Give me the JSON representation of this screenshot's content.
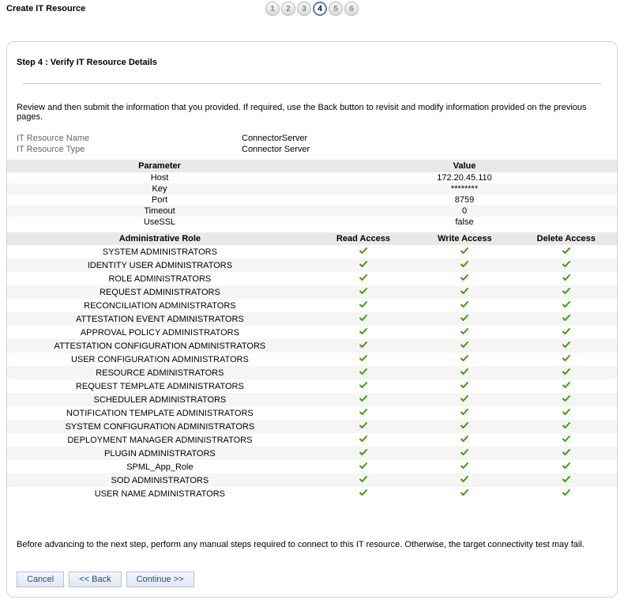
{
  "header": {
    "title": "Create IT Resource",
    "steps": [
      "1",
      "2",
      "3",
      "4",
      "5",
      "6"
    ],
    "active_step_index": 3
  },
  "panel": {
    "step_heading": "Step 4 : Verify IT Resource Details",
    "instruction": "Review and then submit the information that you provided. If required, use the Back button to revisit and modify information provided on the previous pages.",
    "meta": {
      "name_label": "IT Resource Name",
      "name_value": "ConnectorServer",
      "type_label": "IT Resource Type",
      "type_value": "Connector Server"
    },
    "param_headers": {
      "parameter": "Parameter",
      "value": "Value"
    },
    "parameters": [
      {
        "name": "Host",
        "value": "172.20.45.110"
      },
      {
        "name": "Key",
        "value": "********"
      },
      {
        "name": "Port",
        "value": "8759"
      },
      {
        "name": "Timeout",
        "value": "0"
      },
      {
        "name": "UseSSL",
        "value": "false"
      }
    ],
    "role_headers": {
      "role": "Administrative Role",
      "read": "Read Access",
      "write": "Write Access",
      "delete": "Delete Access"
    },
    "roles": [
      {
        "name": "SYSTEM ADMINISTRATORS",
        "read": true,
        "write": true,
        "delete": true
      },
      {
        "name": "IDENTITY USER ADMINISTRATORS",
        "read": true,
        "write": true,
        "delete": true
      },
      {
        "name": "ROLE ADMINISTRATORS",
        "read": true,
        "write": true,
        "delete": true
      },
      {
        "name": "REQUEST ADMINISTRATORS",
        "read": true,
        "write": true,
        "delete": true
      },
      {
        "name": "RECONCILIATION ADMINISTRATORS",
        "read": true,
        "write": true,
        "delete": true
      },
      {
        "name": "ATTESTATION EVENT ADMINISTRATORS",
        "read": true,
        "write": true,
        "delete": true
      },
      {
        "name": "APPROVAL POLICY ADMINISTRATORS",
        "read": true,
        "write": true,
        "delete": true
      },
      {
        "name": "ATTESTATION CONFIGURATION ADMINISTRATORS",
        "read": true,
        "write": true,
        "delete": true
      },
      {
        "name": "USER CONFIGURATION ADMINISTRATORS",
        "read": true,
        "write": true,
        "delete": true
      },
      {
        "name": "RESOURCE ADMINISTRATORS",
        "read": true,
        "write": true,
        "delete": true
      },
      {
        "name": "REQUEST TEMPLATE ADMINISTRATORS",
        "read": true,
        "write": true,
        "delete": true
      },
      {
        "name": "SCHEDULER ADMINISTRATORS",
        "read": true,
        "write": true,
        "delete": true
      },
      {
        "name": "NOTIFICATION TEMPLATE ADMINISTRATORS",
        "read": true,
        "write": true,
        "delete": true
      },
      {
        "name": "SYSTEM CONFIGURATION ADMINISTRATORS",
        "read": true,
        "write": true,
        "delete": true
      },
      {
        "name": "DEPLOYMENT MANAGER ADMINISTRATORS",
        "read": true,
        "write": true,
        "delete": true
      },
      {
        "name": "PLUGIN ADMINISTRATORS",
        "read": true,
        "write": true,
        "delete": true
      },
      {
        "name": "SPML_App_Role",
        "read": true,
        "write": true,
        "delete": true
      },
      {
        "name": "SOD ADMINISTRATORS",
        "read": true,
        "write": true,
        "delete": true
      },
      {
        "name": "USER NAME ADMINISTRATORS",
        "read": true,
        "write": true,
        "delete": true
      }
    ],
    "footer_note": "Before advancing to the next step, perform any manual steps required to connect to this IT resource. Otherwise, the target connectivity test may fail.",
    "buttons": {
      "cancel": "Cancel",
      "back": "<< Back",
      "continue": "Continue >>"
    }
  }
}
